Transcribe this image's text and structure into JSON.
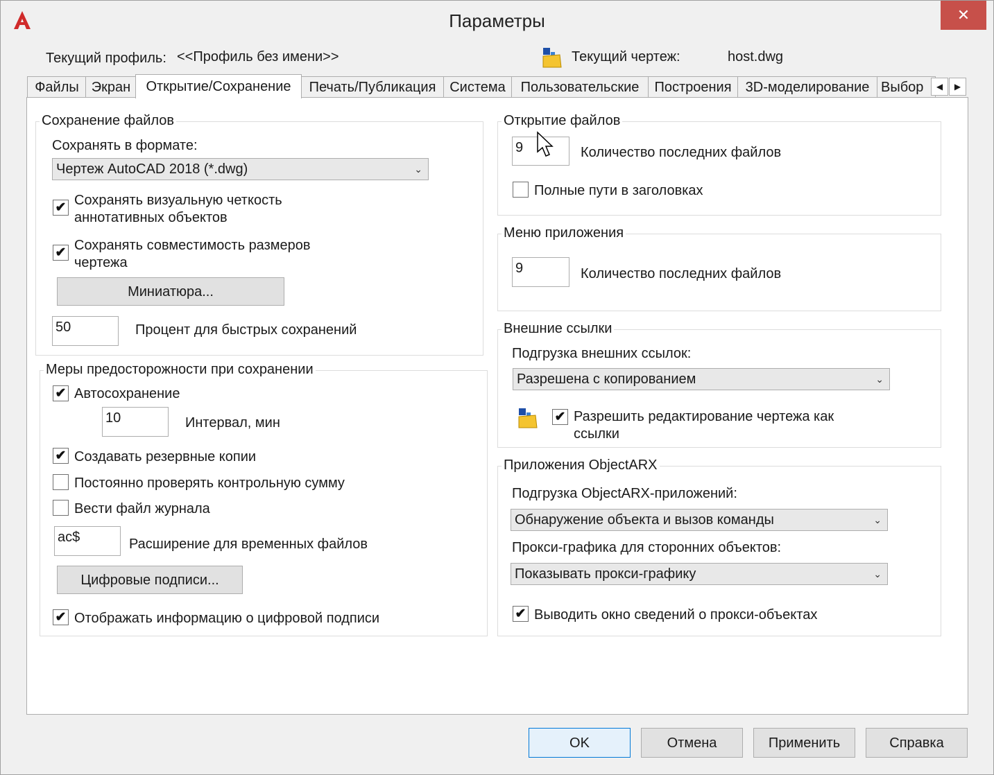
{
  "window": {
    "title": "Параметры",
    "app_icon": "autocad-logo-icon",
    "close_glyph": "✕"
  },
  "header": {
    "profile_label": "Текущий профиль:",
    "profile_value": "<<Профиль без имени>>",
    "drawing_icon": "drawing-file-icon",
    "drawing_label": "Текущий чертеж:",
    "drawing_value": "host.dwg"
  },
  "tabs": [
    {
      "label": "Файлы"
    },
    {
      "label": "Экран"
    },
    {
      "label": "Открытие/Сохранение",
      "active": true
    },
    {
      "label": "Печать/Публикация"
    },
    {
      "label": "Система"
    },
    {
      "label": "Пользовательские"
    },
    {
      "label": "Построения"
    },
    {
      "label": "3D-моделирование"
    },
    {
      "label": "Выбор"
    }
  ],
  "tab_scroll": {
    "left": "◀",
    "right": "▶"
  },
  "file_save": {
    "legend": "Сохранение файлов",
    "format_label": "Сохранять в формате:",
    "format_value": "Чертеж AutoCAD 2018 (*.dwg)",
    "annot_visual_line1": "Сохранять визуальную четкость",
    "annot_visual_line2": "аннотативных объектов",
    "annot_visual_checked": true,
    "dim_compat_line1": "Сохранять совместимость размеров",
    "dim_compat_line2": "чертежа",
    "dim_compat_checked": true,
    "thumbnail_button": "Миниатюра...",
    "incremental_value": "50",
    "incremental_label": "Процент для быстрых сохранений"
  },
  "safety": {
    "legend": "Меры предосторожности при сохранении",
    "autosave_label": "Автосохранение",
    "autosave_checked": true,
    "interval_value": "10",
    "interval_label": "Интервал, мин",
    "backup_label": "Создавать резервные копии",
    "backup_checked": true,
    "crc_label": "Постоянно проверять контрольную сумму",
    "crc_checked": false,
    "log_label": "Вести файл журнала",
    "log_checked": false,
    "temp_ext_value": "ac$",
    "temp_ext_label": "Расширение для временных файлов",
    "digsig_button": "Цифровые подписи...",
    "digsig_info_label": "Отображать информацию о цифровой подписи",
    "digsig_info_checked": true
  },
  "file_open": {
    "legend": "Открытие файлов",
    "recent_value": "9",
    "recent_label": "Количество последних файлов",
    "fullpath_label": "Полные пути в заголовках",
    "fullpath_checked": false
  },
  "app_menu": {
    "legend": "Меню приложения",
    "recent_value": "9",
    "recent_label": "Количество последних файлов"
  },
  "xrefs": {
    "legend": "Внешние ссылки",
    "demand_label": "Подгрузка внешних ссылок:",
    "demand_value": "Разрешена с копированием",
    "edit_icon": "xref-drawing-icon",
    "edit_line1": "Разрешить редактирование чертежа как",
    "edit_line2": "ссылки",
    "edit_checked": true
  },
  "arx": {
    "legend": "Приложения ObjectARX",
    "demand_label": "Подгрузка ObjectARX-приложений:",
    "demand_value": "Обнаружение объекта и вызов команды",
    "proxy_label": "Прокси-графика для сторонних объектов:",
    "proxy_value": "Показывать прокси-графику",
    "proxy_info_label": "Выводить окно сведений о прокси-объектах",
    "proxy_info_checked": true
  },
  "footer": {
    "ok": "OK",
    "cancel": "Отмена",
    "apply": "Применить",
    "help": "Справка"
  },
  "glyphs": {
    "check": "✔",
    "combo_arrow": "⌄"
  }
}
